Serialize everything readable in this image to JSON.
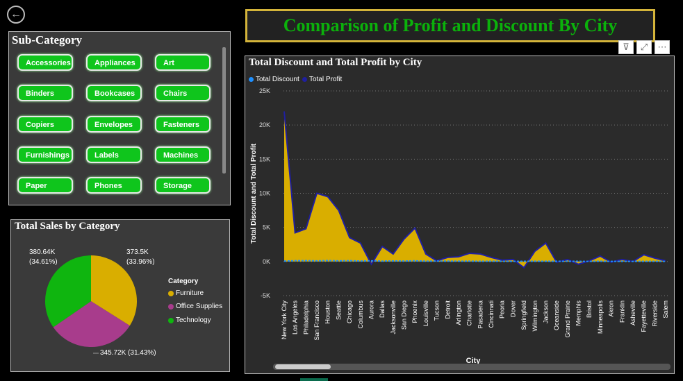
{
  "nav": {
    "back_icon": "←"
  },
  "title": "Comparison of Profit and Discount By City",
  "subcategory": {
    "title": "Sub-Category",
    "items": [
      "Accessories",
      "Appliances",
      "Art",
      "Binders",
      "Bookcases",
      "Chairs",
      "Copiers",
      "Envelopes",
      "Fasteners",
      "Furnishings",
      "Labels",
      "Machines",
      "Paper",
      "Phones",
      "Storage"
    ]
  },
  "visual_tools": {
    "filter_icon": "⊽",
    "focus_icon": "⤢",
    "more_icon": "⋯"
  },
  "pie": {
    "title": "Total Sales by Category",
    "legend_title": "Category",
    "slices": [
      {
        "name": "Furniture",
        "label_value": "373.5K",
        "label_pct": "(33.96%)",
        "color": "#d9ae00"
      },
      {
        "name": "Office Supplies",
        "label_value": "345.72K",
        "label_pct": "(31.43%)",
        "color": "#a83c8c"
      },
      {
        "name": "Technology",
        "label_value": "380.64K",
        "label_pct": "(34.61%)",
        "color": "#0fb50f"
      }
    ]
  },
  "chart_data": {
    "type": "area",
    "title": "Total Discount and Total Profit by City",
    "xlabel": "City",
    "ylabel": "Total Discount and Total Profit",
    "ylim": [
      -5000,
      25000
    ],
    "yticks": [
      "-5K",
      "0K",
      "5K",
      "10K",
      "15K",
      "20K",
      "25K"
    ],
    "ytick_values": [
      -5000,
      0,
      5000,
      10000,
      15000,
      20000,
      25000
    ],
    "categories": [
      "New York City",
      "Los Angeles",
      "Philadelphia",
      "San Francisco",
      "Houston",
      "Seattle",
      "Chicago",
      "Columbus",
      "Aurora",
      "Dallas",
      "Jacksonville",
      "San Diego",
      "Phoenix",
      "Louisville",
      "Tucson",
      "Detroit",
      "Arlington",
      "Charlotte",
      "Pasadena",
      "Cincinnati",
      "Peoria",
      "Dover",
      "Springfield",
      "Wilmington",
      "Jackson",
      "Oceanside",
      "Grand Prairie",
      "Memphis",
      "Bristol",
      "Minneapolis",
      "Akron",
      "Franklin",
      "Asheville",
      "Fayetteville",
      "Riverside",
      "Salem"
    ],
    "series": [
      {
        "name": "Total Discount",
        "color": "#1e90ff",
        "values": [
          60,
          120,
          130,
          100,
          140,
          100,
          120,
          70,
          100,
          60,
          90,
          70,
          110,
          40,
          60,
          50,
          40,
          50,
          30,
          40,
          30,
          20,
          40,
          30,
          40,
          30,
          30,
          30,
          20,
          30,
          20,
          20,
          20,
          20,
          20,
          20
        ]
      },
      {
        "name": "Total Profit",
        "color": "#1f1fa0",
        "values": [
          22000,
          4200,
          4800,
          10000,
          9500,
          7500,
          3500,
          2700,
          -400,
          2200,
          1100,
          3300,
          4900,
          1100,
          100,
          600,
          700,
          1200,
          1100,
          600,
          200,
          300,
          -900,
          1500,
          2700,
          -100,
          300,
          -400,
          100,
          800,
          -100,
          300,
          0,
          1000,
          500,
          100
        ]
      }
    ]
  }
}
